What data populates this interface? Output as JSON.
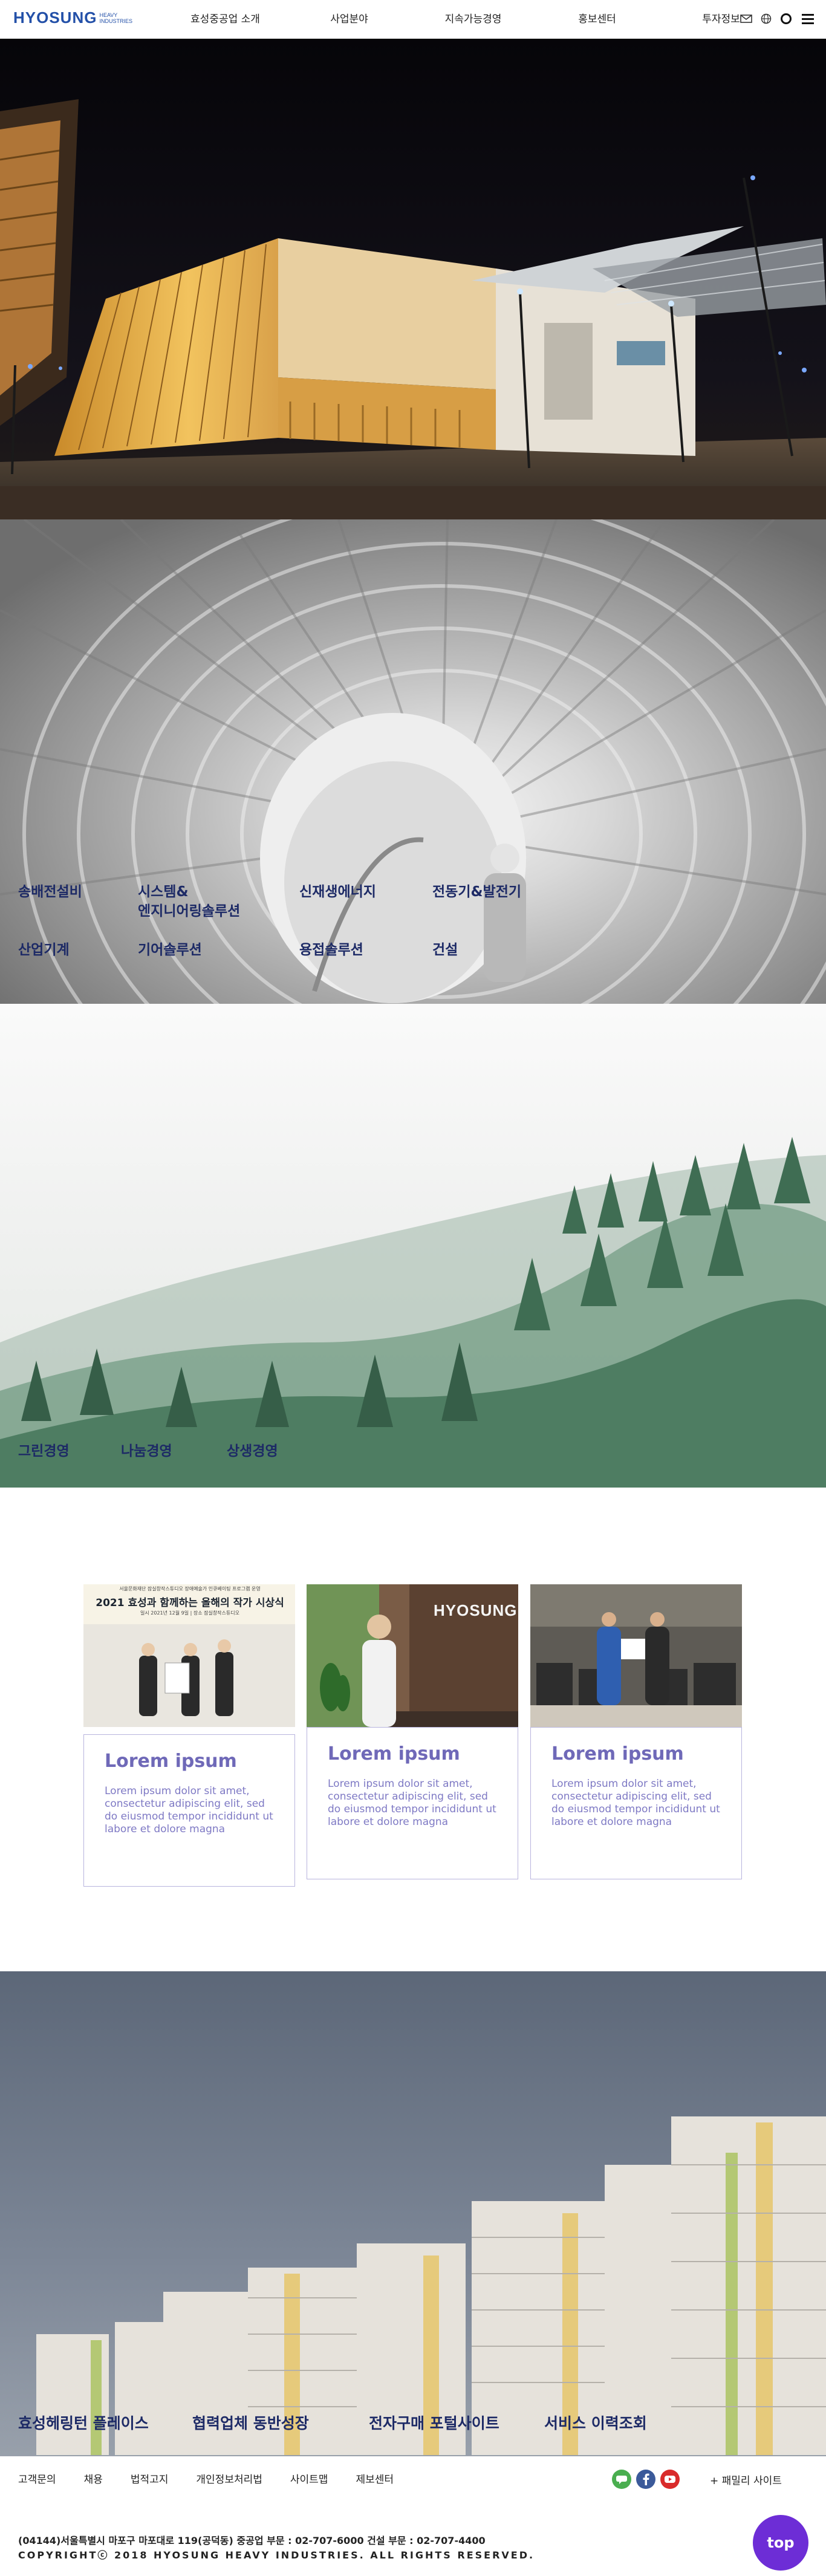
{
  "header": {
    "logo_main": "HYOSUNG",
    "logo_sub": "HEAVY INDUSTRIES",
    "nav": [
      "효성중공업 소개",
      "사업분야",
      "지속가능경영",
      "홍보센터",
      "투자정보"
    ],
    "icons": [
      "mail-icon",
      "globe-icon",
      "circle-icon",
      "menu-icon"
    ]
  },
  "business": {
    "items": [
      "송배전설비",
      "시스템&\n엔지니어링솔루션",
      "신재생에너지",
      "전동기&발전기",
      "산업기계",
      "기어솔루션",
      "용접솔루션",
      "건설"
    ]
  },
  "sustainability": {
    "items": [
      "그린경영",
      "나눔경영",
      "상생경영"
    ]
  },
  "news": {
    "card1_banner_small": "서울문화재단 잠실창작스튜디오 장애예술가 인큐베이팅 프로그램 운영",
    "card1_banner_title": "2021 효성과 함께하는 올해의 작가 시상식",
    "card1_banner_info": "일시 2021년 12월 9일 | 장소 잠실창작스튜디오",
    "card2_sign": "HYOSUNG",
    "cards": [
      {
        "title": "Lorem ipsum",
        "text": "Lorem ipsum dolor sit amet, consectetur adipiscing elit, sed do eiusmod tempor incididunt ut labore et dolore magna"
      },
      {
        "title": "Lorem ipsum",
        "text": "Lorem ipsum dolor sit amet, consectetur adipiscing elit, sed do eiusmod tempor incididunt ut labore et dolore magna"
      },
      {
        "title": "Lorem ipsum",
        "text": "Lorem ipsum dolor sit amet, consectetur adipiscing elit, sed do eiusmod tempor incididunt ut labore et dolore magna"
      }
    ]
  },
  "portal": {
    "items": [
      "효성헤링턴 플레이스",
      "협력업체 동반성장",
      "전자구매 포털사이트",
      "서비스 이력조회"
    ]
  },
  "footer": {
    "links": [
      "고객문의",
      "채용",
      "법적고지",
      "개인정보처리법",
      "사이트맵",
      "제보센터"
    ],
    "sns": [
      "talk-icon",
      "facebook-icon",
      "youtube-icon"
    ],
    "family": "+ 패밀리 사이트",
    "address": "(04144)서울특별시 마포구 마포대로 119(공덕동) 중공업 부문 : 02-707-6000 건설 부문 : 02-707-4400",
    "copyright": "COPYRIGHTⓒ 2018 HYOSUNG HEAVY INDUSTRIES. ALL RIGHTS RESERVED.",
    "top": "top"
  }
}
